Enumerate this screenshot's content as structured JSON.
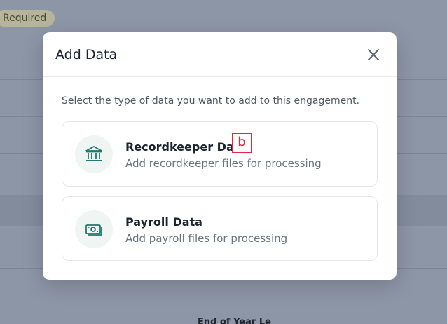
{
  "background": {
    "badge_text": "Required",
    "bottom_text": "End of Year Le"
  },
  "modal": {
    "title": "Add Data",
    "close_icon": "close-icon",
    "description": "Select the type of data you want to add to this engagement.",
    "options": [
      {
        "title": "Recordkeeper Data",
        "subtitle": "Add recordkeeper files for processing",
        "icon": "bank-icon",
        "marker": "b"
      },
      {
        "title": "Payroll Data",
        "subtitle": "Add payroll files for processing",
        "icon": "money-icon"
      }
    ]
  },
  "colors": {
    "accent": "#1f7a6c",
    "overlay": "#8d96a7",
    "marker": "#e5293a"
  }
}
